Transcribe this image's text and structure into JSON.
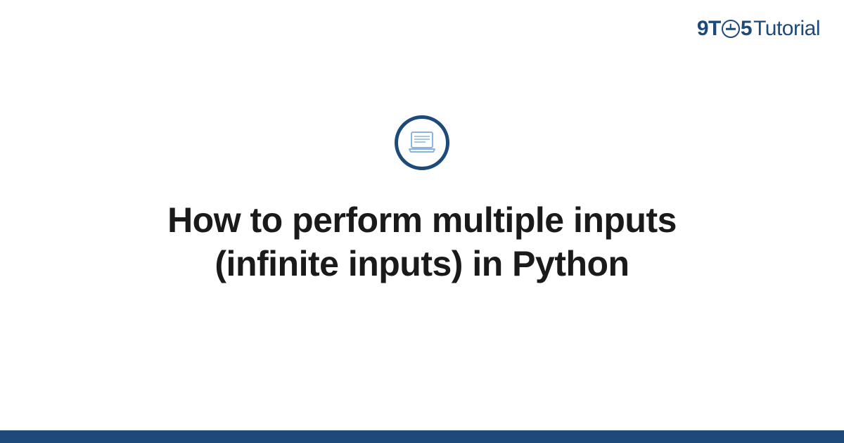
{
  "brand": {
    "prefix": "9T",
    "middle": "5",
    "suffix": "Tutorial"
  },
  "title": "How to perform multiple inputs (infinite inputs) in Python",
  "colors": {
    "primary": "#1e4a7a",
    "icon_accent": "#8bb4e0"
  }
}
